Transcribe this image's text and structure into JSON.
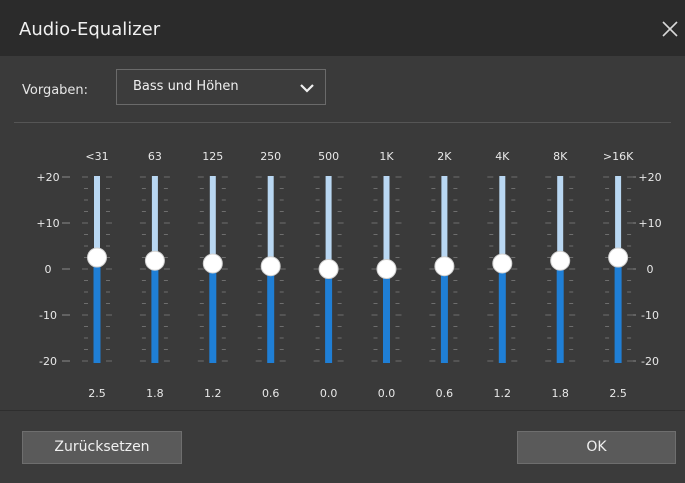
{
  "dialog": {
    "title": "Audio-Equalizer",
    "close_icon": "close-icon"
  },
  "preset": {
    "label": "Vorgaben:",
    "selected": "Bass und Höhen",
    "dropdown_icon": "chevron-down-icon"
  },
  "scale": {
    "labels": [
      "+20",
      "+10",
      "0",
      "-10",
      "-20"
    ],
    "values": [
      20,
      10,
      0,
      -10,
      -20
    ],
    "min": -20,
    "max": 20
  },
  "bands": [
    {
      "freq": "<31",
      "value_label": "2.5",
      "value": 2.5
    },
    {
      "freq": "63",
      "value_label": "1.8",
      "value": 1.8
    },
    {
      "freq": "125",
      "value_label": "1.2",
      "value": 1.2
    },
    {
      "freq": "250",
      "value_label": "0.6",
      "value": 0.6
    },
    {
      "freq": "500",
      "value_label": "0.0",
      "value": 0.0
    },
    {
      "freq": "1K",
      "value_label": "0.0",
      "value": 0.0
    },
    {
      "freq": "2K",
      "value_label": "0.6",
      "value": 0.6
    },
    {
      "freq": "4K",
      "value_label": "1.2",
      "value": 1.2
    },
    {
      "freq": "8K",
      "value_label": "1.8",
      "value": 1.8
    },
    {
      "freq": ">16K",
      "value_label": "2.5",
      "value": 2.5
    }
  ],
  "colors": {
    "track_upper": "#b9d7f2",
    "track_lower": "#1f7fd6",
    "knob": "#ffffff"
  },
  "footer": {
    "reset_label": "Zurücksetzen",
    "ok_label": "OK"
  }
}
